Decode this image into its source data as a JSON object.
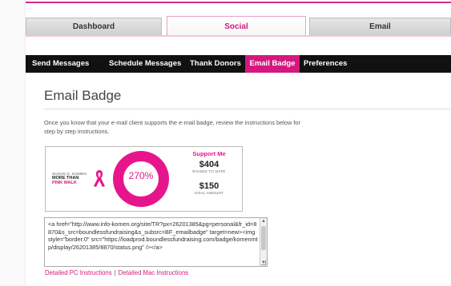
{
  "tabs": [
    {
      "label": "Dashboard"
    },
    {
      "label": "Social"
    },
    {
      "label": "Email"
    }
  ],
  "subnav": [
    {
      "label": "Send Messages"
    },
    {
      "label": "Schedule Messages"
    },
    {
      "label": "Thank Donors"
    },
    {
      "label": "Email Badge"
    },
    {
      "label": "Preferences"
    }
  ],
  "page": {
    "title": "Email Badge",
    "description": "Once you know that your e-mail client supports the e-mail badge, review the instructions below for step by step instructions."
  },
  "badge": {
    "brand_line1": "SUSAN G. KOMEN",
    "brand_line2": "MORE THAN",
    "brand_line3": "PINK WALK",
    "percent": "270%",
    "support_label": "Support Me",
    "raised_amount": "$404",
    "raised_label": "RAISED TO DATE",
    "goal_amount": "$150",
    "goal_label": "GOAL AMOUNT",
    "accent_color": "#e7158c"
  },
  "code": {
    "value": "<a href=\"http://www.info-komen.org/site/TR?px=26201385&pg=personal&fr_id=8870&s_src=boundlessfundraising&s_subsrc=BF_emailbadge\" target=new><img style=\"border:0\" src=\"https://loadprod.boundlessfundraising.com/badge/komenmtp/display/26201385/8870/status.png\" /></a>"
  },
  "links": {
    "pc": "Detailed PC Instructions",
    "separator": "|",
    "mac": "Detailed Mac Instructions"
  },
  "colors": {
    "brand_pink": "#d4187e",
    "subnav_bg": "#111111"
  }
}
